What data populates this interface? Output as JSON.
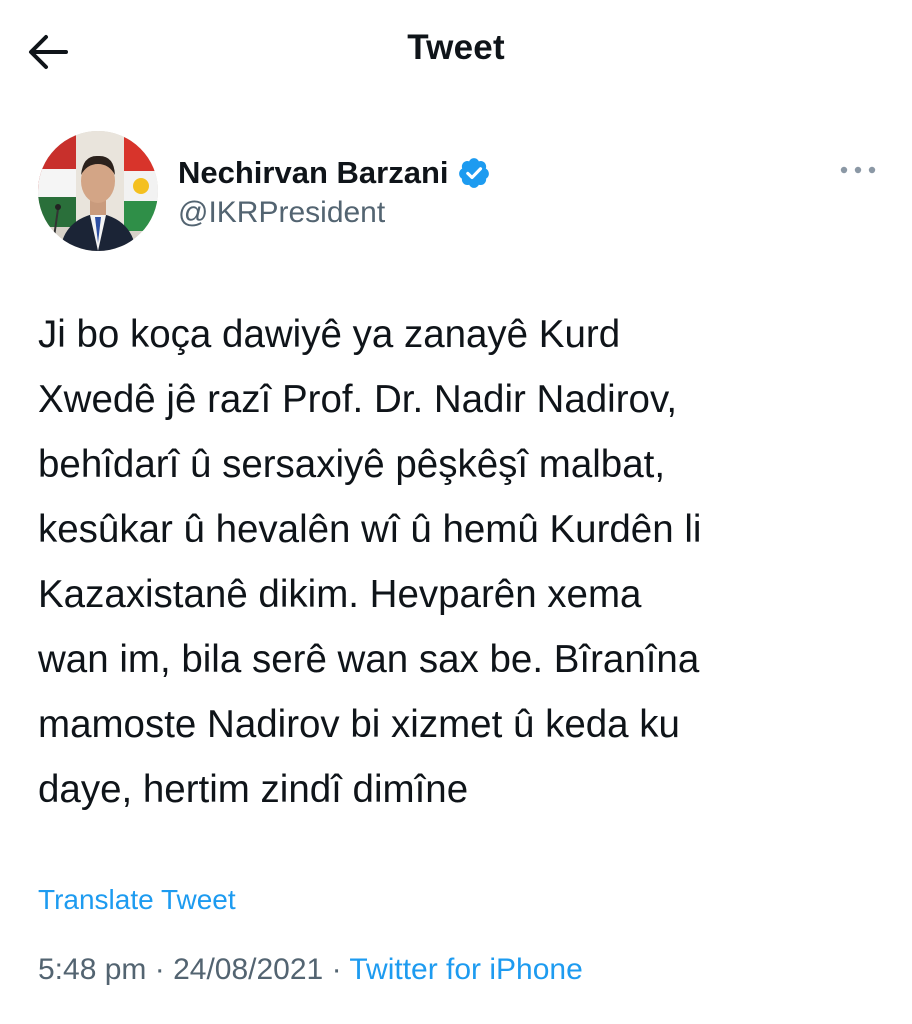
{
  "header": {
    "title": "Tweet",
    "back_icon": "arrow-left-icon"
  },
  "author": {
    "display_name": "Nechirvan Barzani",
    "handle": "@IKRPresident",
    "verified_icon": "verified-badge-icon",
    "more_icon": "more-horizontal-icon",
    "avatar": "profile-photo"
  },
  "tweet": {
    "text": "Ji bo koça dawiyê ya zanayê Kurd\nXwedê jê razî Prof. Dr. Nadir Nadirov,\nbehîdarî û sersaxiyê pêşkêşî malbat,\nkesûkar û hevalên wî û hemû Kurdên li\nKazaxistanê dikim. Hevparên xema\nwan im, bila serê wan sax be. Bîranîna\nmamoste Nadirov bi xizmet û keda ku\ndaye, hertim zindî dimîne",
    "translate_label": "Translate Tweet"
  },
  "meta": {
    "time": "5:48 pm",
    "separator": " · ",
    "date": "24/08/2021",
    "source": "Twitter for iPhone"
  },
  "colors": {
    "accent": "#1d9bf0",
    "text": "#0f1419",
    "secondary": "#536471"
  }
}
